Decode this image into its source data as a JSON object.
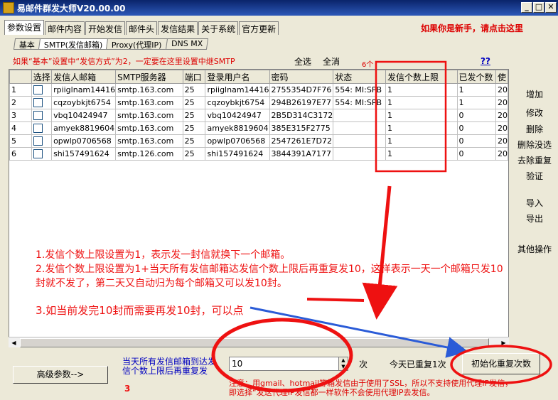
{
  "window": {
    "title": "易邮件群发大师V20.00.00",
    "min": "_",
    "max": "□",
    "close": "✕"
  },
  "tabs": [
    "参数设置",
    "邮件内容",
    "开始发信",
    "邮件头",
    "发信结果",
    "关于系统",
    "官方更新"
  ],
  "newbie_link": "如果你是新手，请点击这里",
  "subtabs": [
    "基本",
    "SMTP(发信邮箱)",
    "Proxy(代理IP)",
    "DNS MX"
  ],
  "warning": "如果“基本”设置中“发信方式”为2，一定要在这里设置中继SMTP",
  "select_all": "全选",
  "deselect_all": "全消",
  "count_label": "6个",
  "help": "??",
  "table": {
    "headers": [
      "",
      "选择",
      "发信人邮箱",
      "SMTP服务器",
      "端口",
      "登录用户名",
      "密码",
      "状态",
      "发信个数上限",
      "已发个数",
      "使"
    ],
    "rows": [
      [
        "1",
        "",
        "rpiiglnam14416",
        "smtp.163.com",
        "25",
        "rpiiglnam14416",
        "2755354D7F76",
        "554: MI:SPB",
        "1",
        "1",
        "20"
      ],
      [
        "2",
        "",
        "cqzoybkjt6754",
        "smtp.163.com",
        "25",
        "cqzoybkjt6754",
        "294B26197E77",
        "554: MI:SPB",
        "1",
        "1",
        "20"
      ],
      [
        "3",
        "",
        "vbq10424947",
        "smtp.163.com",
        "25",
        "vbq10424947",
        "2B5D314C3172",
        "",
        "1",
        "0",
        "20"
      ],
      [
        "4",
        "",
        "amyek8819604",
        "smtp.163.com",
        "25",
        "amyek8819604",
        "385E315F2775",
        "",
        "1",
        "0",
        "20"
      ],
      [
        "5",
        "",
        "opwlp0706568",
        "smtp.163.com",
        "25",
        "opwlp0706568",
        "2547261E7D72",
        "",
        "1",
        "0",
        "20"
      ],
      [
        "6",
        "",
        "shi157491624",
        "smtp.126.com",
        "25",
        "shi157491624",
        "3844391A7177",
        "",
        "1",
        "0",
        "20"
      ]
    ]
  },
  "side": {
    "add": "增加",
    "edit": "修改",
    "delete": "删除",
    "delete_unselected": "删除没选",
    "dedupe": "去除重复",
    "verify": "验证",
    "import": "导入",
    "export": "导出",
    "other": "其他操作"
  },
  "annotations": {
    "line1": "1.发信个数上限设置为1，表示发一封信就换下一个邮箱。",
    "line2": "2.发信个数上限设置为1+当天所有发信邮箱达发信个数上限后再重复发10，这样表示一天一个邮箱只发10",
    "line3": "封就不发了，第二天又自动归为每个邮箱又可以发10封。",
    "line4": "3.如当前发完10封而需要再发10封，可以点",
    "three": "3"
  },
  "bottom": {
    "advanced": "高级参数-->",
    "blue1": "当天所有发信邮箱到达发",
    "blue2": "信个数上限后再重复发",
    "repeat_value": "10",
    "times": "次",
    "today_repeat": "今天已重复1次",
    "init_button": "初始化重复次数",
    "notice1": "注意：用gmail、hotmail等箱发信由于使用了SSL，所以不支持使用代理IP发信，",
    "notice2": "即选择“发送代理IP发信都一样软件不会使用代理IP去发信。"
  },
  "colors": {
    "accent_red": "#e11",
    "link_blue": "#0000c0",
    "arrow_blue": "#2a5bd7"
  }
}
